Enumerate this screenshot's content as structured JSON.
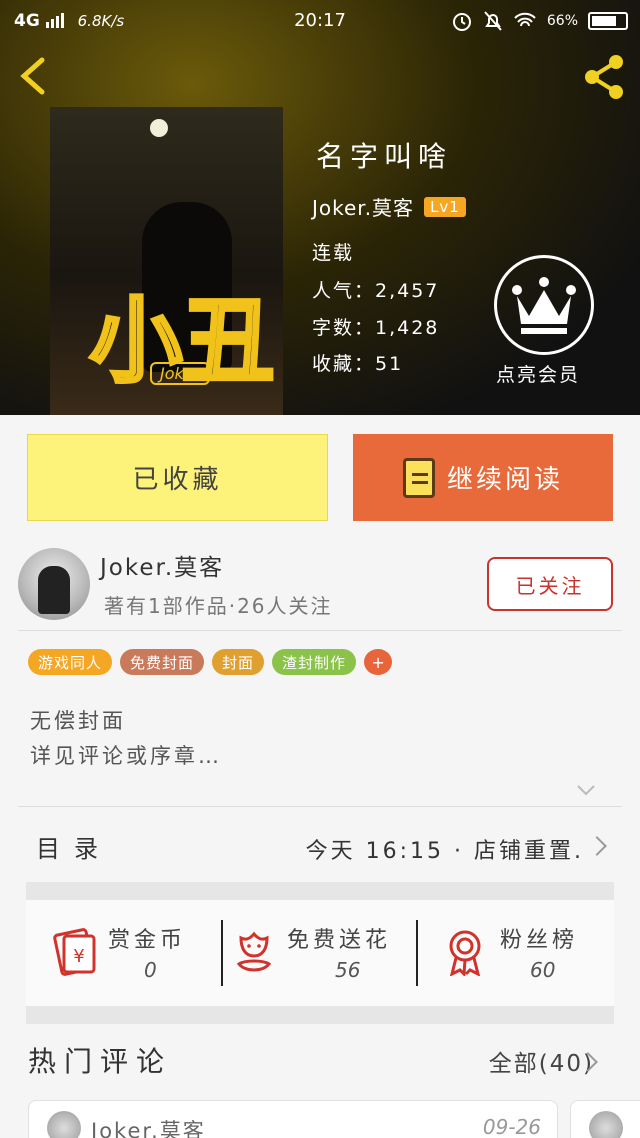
{
  "status_bar": {
    "network": "4G",
    "speed": "6.8K/s",
    "time": "20:17",
    "battery": "66%"
  },
  "book": {
    "title": "名字叫啥",
    "author": "Joker.莫客",
    "level": "Lv1",
    "status": "连载",
    "popularity": "人气：2,457",
    "word_count": "字数：1,428",
    "favorites": "收藏：51",
    "cover_logo": "小丑",
    "cover_tag": "Joker"
  },
  "vip": {
    "label": "点亮会员"
  },
  "actions": {
    "collected_label": "已收藏",
    "continue_label": "继续阅读"
  },
  "author_row": {
    "name": "Joker.莫客",
    "summary": "著有1部作品·26人关注",
    "follow_label": "已关注"
  },
  "tags": [
    {
      "label": "游戏同人",
      "color": "#f5a623"
    },
    {
      "label": "免费封面",
      "color": "#c87a5a"
    },
    {
      "label": "封面",
      "color": "#e0a030"
    },
    {
      "label": "渣封制作",
      "color": "#8bc34a"
    }
  ],
  "tag_add": "+",
  "description": {
    "line1": "无偿封面",
    "line2": "详见评论或序章…"
  },
  "toc": {
    "label": "目录",
    "latest": "今天 16:15 · 店铺重置."
  },
  "stats": [
    {
      "label": "赏金币",
      "value": "0",
      "icon": "red-envelope-icon"
    },
    {
      "label": "免费送花",
      "value": "56",
      "icon": "flower-icon"
    },
    {
      "label": "粉丝榜",
      "value": "60",
      "icon": "medal-icon"
    }
  ],
  "hot_comments": {
    "title": "热门评论",
    "all_label": "全部(40)",
    "first": {
      "name": "Joker.莫客",
      "date": "09-26"
    }
  },
  "colors": {
    "accent": "#e86a3a",
    "collected_bg": "#fdf27a",
    "follow": "#c9332b"
  }
}
